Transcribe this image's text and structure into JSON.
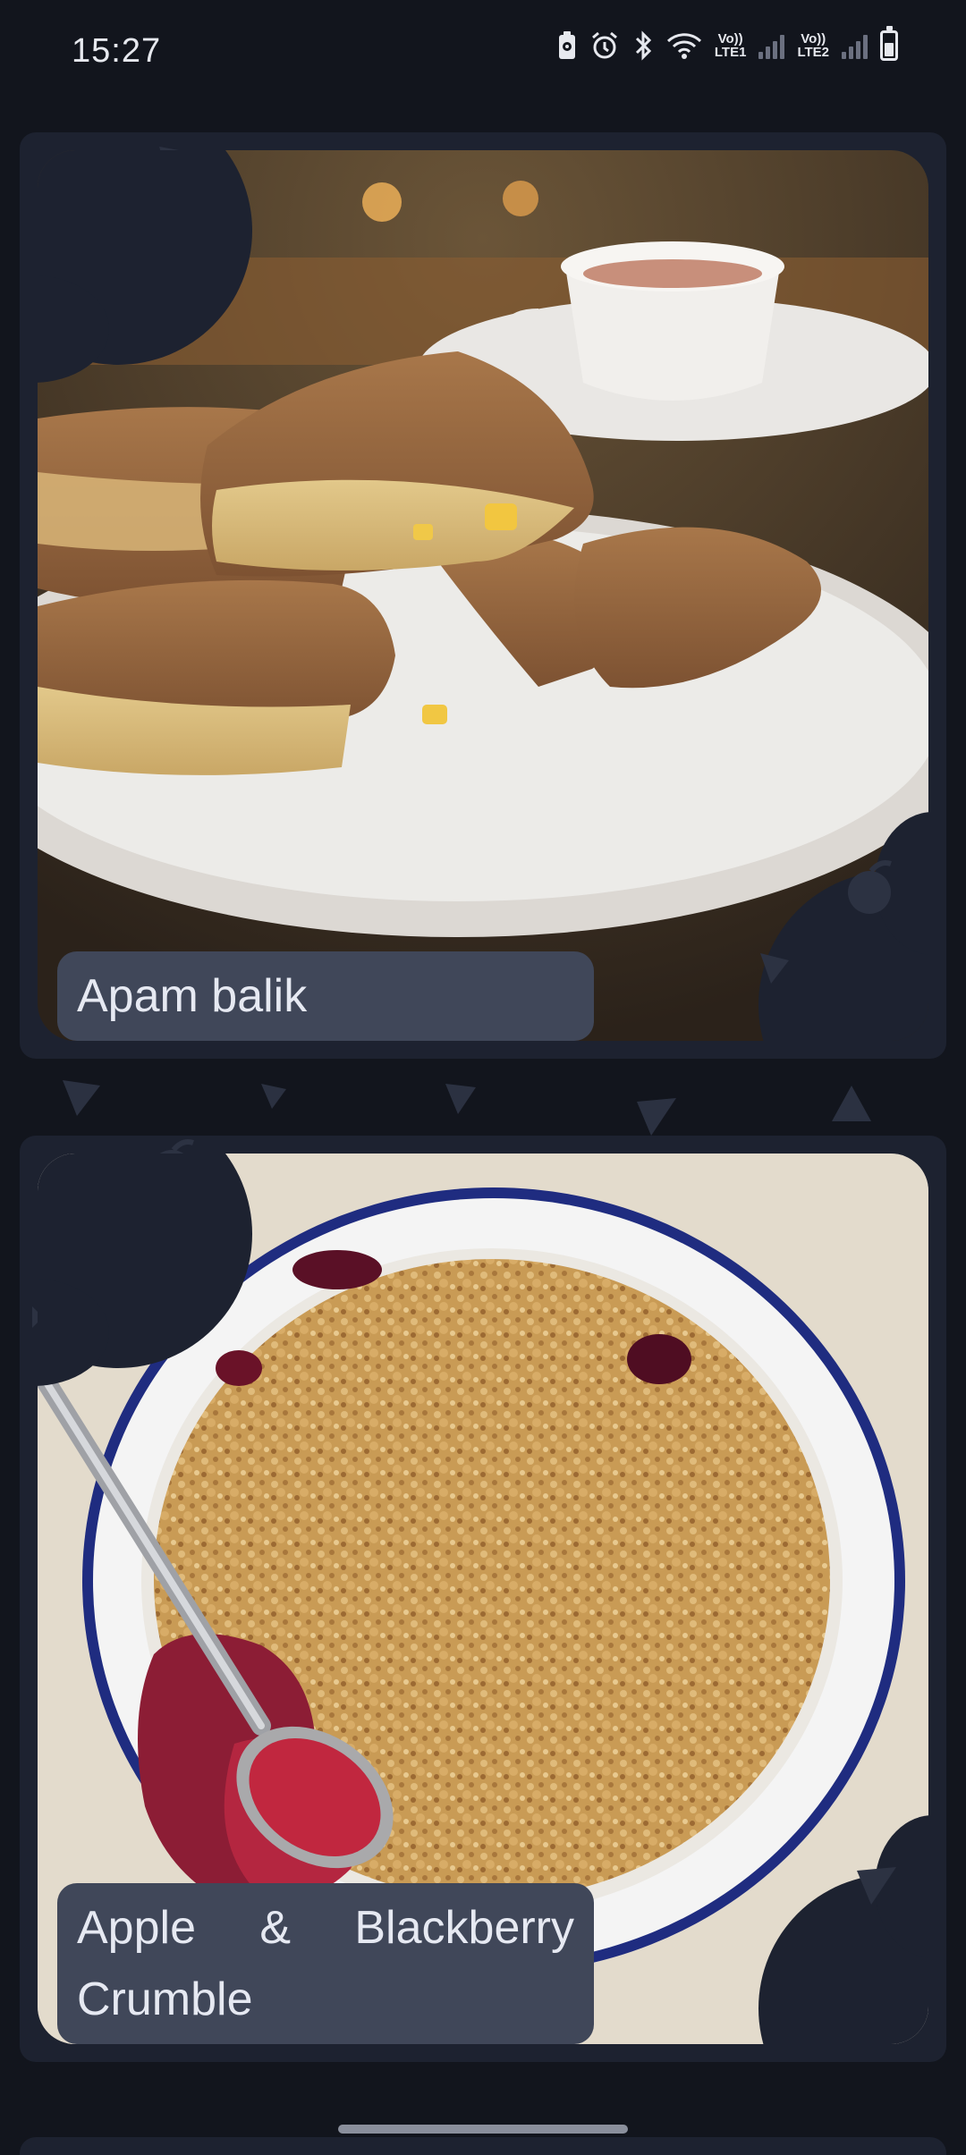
{
  "status_bar": {
    "time": "15:27",
    "icons": [
      "battery-saver-icon",
      "alarm-icon",
      "bluetooth-icon",
      "wifi-icon",
      "volte-lte1-signal-icon",
      "volte-lte2-signal-icon",
      "battery-icon"
    ],
    "sim1_label_top": "Vo))",
    "sim1_label_bottom": "LTE1",
    "sim2_label_top": "Vo))",
    "sim2_label_bottom": "LTE2"
  },
  "recipes": [
    {
      "title": "Apam balik",
      "image": "apam-balik-photo"
    },
    {
      "title": "Apple & Blackberry Crumble",
      "image": "apple-blackberry-crumble-photo"
    }
  ],
  "colors": {
    "background": "#12151d",
    "card": "#1d2230",
    "caption": "#404759",
    "doodle": "#2c3242"
  }
}
